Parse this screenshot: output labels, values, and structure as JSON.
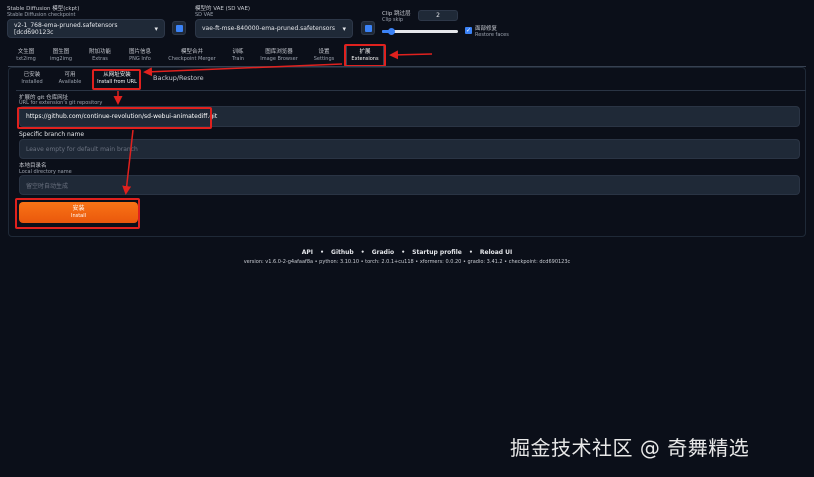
{
  "header": {
    "checkpoint_label_cn": "Stable Diffusion 模型(ckpt)",
    "checkpoint_label_en": "Stable Diffusion checkpoint",
    "checkpoint_value": "v2-1_768-ema-pruned.safetensors [dcd690123c",
    "vae_label_cn": "模型的 VAE (SD VAE)",
    "vae_label_en": "SD VAE",
    "vae_value": "vae-ft-mse-840000-ema-pruned.safetensors",
    "clip_label_cn": "Clip 跳过层",
    "clip_label_en": "Clip skip",
    "clip_value": "2",
    "restore_cn": "面部修复",
    "restore_en": "Restore faces"
  },
  "tabs": [
    {
      "cn": "文生图",
      "en": "txt2img"
    },
    {
      "cn": "图生图",
      "en": "img2img"
    },
    {
      "cn": "附加功能",
      "en": "Extras"
    },
    {
      "cn": "图片信息",
      "en": "PNG Info"
    },
    {
      "cn": "模型合并",
      "en": "Checkpoint Merger"
    },
    {
      "cn": "训练",
      "en": "Train"
    },
    {
      "cn": "图库浏览器",
      "en": "Image Browser"
    },
    {
      "cn": "设置",
      "en": "Settings"
    },
    {
      "cn": "扩展",
      "en": "Extensions"
    }
  ],
  "subtabs": [
    {
      "cn": "已安装",
      "en": "Installed"
    },
    {
      "cn": "可用",
      "en": "Available"
    },
    {
      "cn": "从网址安装",
      "en": "Install from URL"
    },
    {
      "label": "Backup/Restore"
    }
  ],
  "form": {
    "url_label_cn": "扩展的 git 仓库网址",
    "url_label_en": "URL for extension's git repository",
    "url_value": "https://github.com/continue-revolution/sd-webui-animatediff.git",
    "branch_label": "Specific branch name",
    "branch_placeholder": "Leave empty for default main branch",
    "dir_label_cn": "本地目录名",
    "dir_label_en": "Local directory name",
    "dir_placeholder": "留空时自动生成",
    "install_cn": "安装",
    "install_en": "Install"
  },
  "footer": {
    "links": [
      "API",
      "Github",
      "Gradio",
      "Startup profile",
      "Reload UI"
    ],
    "sep": "•",
    "version": "version: v1.6.0-2-g4afaaf8a  •  python: 3.10.10  •  torch: 2.0.1+cu118  •  xformers: 0.0.20  •  gradio: 3.41.2  •  checkpoint: dcd690123c"
  },
  "watermark": "掘金技术社区 @ 奇舞精选",
  "colors": {
    "accent": "#f97316",
    "annotation": "#e0211e",
    "background": "#0b0f19"
  }
}
